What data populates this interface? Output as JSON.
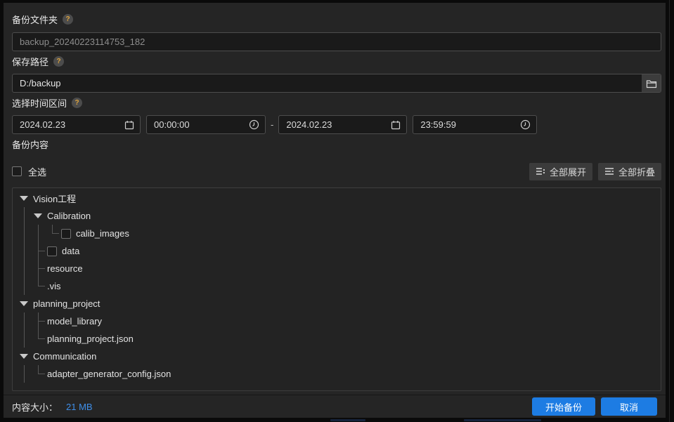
{
  "backup_folder": {
    "label": "备份文件夹",
    "help_mark": "?",
    "value": "backup_20240223114753_182"
  },
  "save_path": {
    "label": "保存路径",
    "help_mark": "?",
    "value": "D:/backup"
  },
  "time_range": {
    "label": "选择时间区间",
    "help_mark": "?",
    "start_date": "2024.02.23",
    "start_time": "00:00:00",
    "dash": "-",
    "end_date": "2024.02.23",
    "end_time": "23:59:59"
  },
  "content_section": {
    "label": "备份内容",
    "select_all_label": "全选",
    "expand_all_label": "全部展开",
    "collapse_all_label": "全部折叠"
  },
  "tree": {
    "nodes": [
      {
        "label": "Vision工程",
        "expanded": true,
        "children": [
          {
            "label": "Calibration",
            "expanded": true,
            "children": [
              {
                "label": "calib_images",
                "checkbox": true
              }
            ]
          },
          {
            "label": "data",
            "checkbox": true
          },
          {
            "label": "resource"
          },
          {
            "label": ".vis"
          }
        ]
      },
      {
        "label": "planning_project",
        "expanded": true,
        "children": [
          {
            "label": "model_library"
          },
          {
            "label": "planning_project.json"
          }
        ]
      },
      {
        "label": "Communication",
        "expanded": true,
        "more_following": true,
        "children": [
          {
            "label": "adapter_generator_config.json"
          }
        ]
      }
    ]
  },
  "footer": {
    "size_label": "内容大小：",
    "size_value": "21 MB",
    "start_label": "开始备份",
    "cancel_label": "取消"
  },
  "icons": {
    "help": "help-icon",
    "calendar": "calendar-icon",
    "clock": "clock-icon",
    "folder": "folder-icon",
    "expand_all": "expand-all-icon",
    "collapse_all": "collapse-all-icon"
  },
  "colors": {
    "accent_blue": "#1d7ce3",
    "size_value_blue": "#3f8fe9",
    "help_mark_orange": "#dfa53e"
  }
}
